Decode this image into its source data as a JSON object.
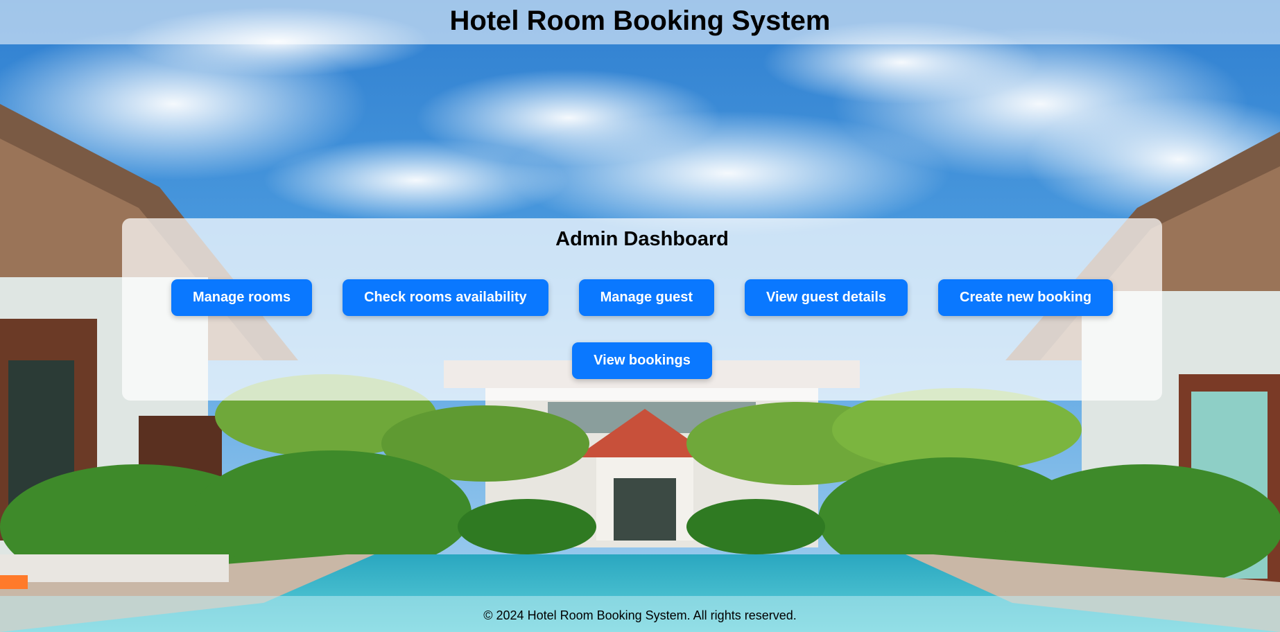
{
  "header": {
    "title": "Hotel Room Booking System"
  },
  "dashboard": {
    "title": "Admin Dashboard",
    "buttons": [
      {
        "label": "Manage rooms"
      },
      {
        "label": "Check rooms availability"
      },
      {
        "label": "Manage guest"
      },
      {
        "label": "View guest details"
      },
      {
        "label": "Create new booking"
      },
      {
        "label": "View bookings"
      }
    ]
  },
  "footer": {
    "text": "© 2024 Hotel Room Booking System. All rights reserved."
  },
  "colors": {
    "button_bg": "#0a78ff",
    "button_text": "#ffffff"
  }
}
